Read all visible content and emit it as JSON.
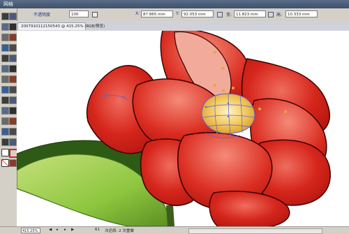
{
  "window": {
    "title": "网格"
  },
  "control_bar": {
    "mode_label": "不透明度",
    "opacity_value": "100",
    "x_label": "X:",
    "x_value": "87.865 mm",
    "y_label": "Y:",
    "y_value": "92.053 mm",
    "w_label": "宽:",
    "w_value": "11.823 mm",
    "h_label": "高:",
    "h_value": "10.333 mm"
  },
  "document_tab": {
    "label": "2007910112150543 @ 415.25% (RGB/预览)"
  },
  "status_bar": {
    "zoom": "415.25%",
    "page_number": "61",
    "status_text": "次还原: 2 次重做",
    "nav_first": "◀",
    "nav_prev": "◂",
    "nav_next": "▸",
    "nav_last": "▶"
  },
  "colors": {
    "petal_red": "#d6261c",
    "petal_highlight": "#ee7b6c",
    "stamen_yellow": "#e8b63a",
    "leaf_green": "#8dc63f",
    "anchor_point": "#e8a63a",
    "mesh_line": "#5a5fd0"
  },
  "tools": [
    "selection-tool",
    "direct-selection-tool",
    "magic-wand-tool",
    "lasso-tool",
    "pen-tool",
    "type-tool",
    "line-tool",
    "rectangle-tool",
    "paintbrush-tool",
    "pencil-tool",
    "rotate-tool",
    "scale-tool",
    "warp-tool",
    "free-transform-tool",
    "symbol-sprayer-tool",
    "graph-tool",
    "mesh-tool",
    "gradient-tool",
    "eyedropper-tool",
    "blend-tool",
    "live-paint-tool",
    "slice-tool",
    "eraser-tool",
    "scissors-tool",
    "hand-tool",
    "zoom-tool",
    "fill-swatch",
    "stroke-swatch",
    "none-swatch",
    "screen-mode"
  ]
}
